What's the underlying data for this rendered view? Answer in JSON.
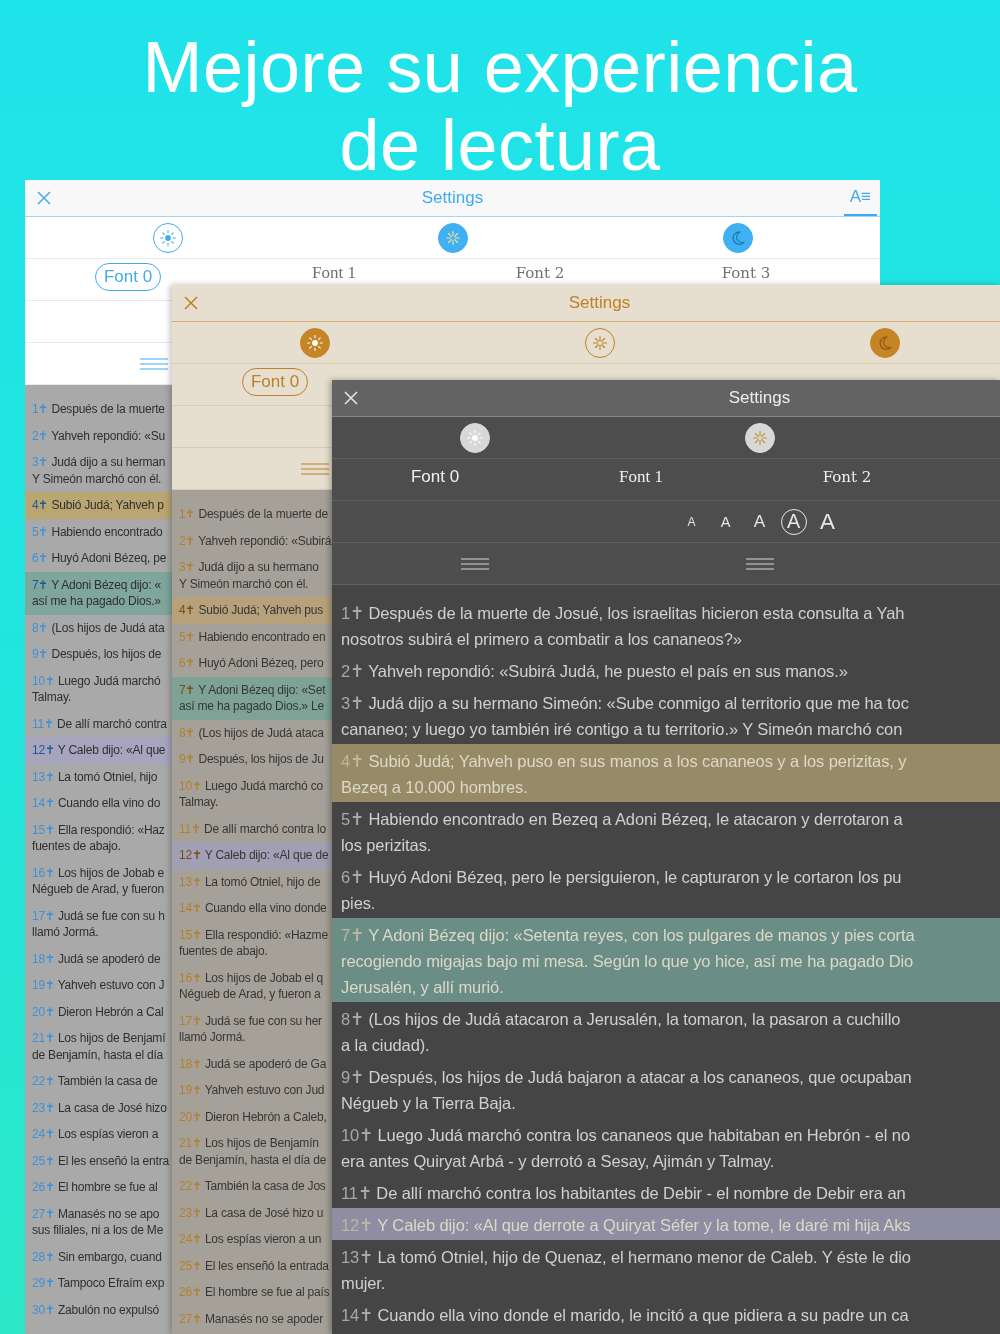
{
  "headline": "Mejore su experiencia de lectura",
  "panels": [
    {
      "kind": "light",
      "title": "Settings",
      "format_button": {
        "label": "A≡",
        "selected": true
      },
      "themes": [
        {
          "kind": "light",
          "selected": true
        },
        {
          "kind": "sepia",
          "selected": false
        },
        {
          "kind": "dark",
          "selected": false
        }
      ],
      "fonts": [
        {
          "label": "Font 0",
          "kind": "sans",
          "selected": true
        },
        {
          "label": "Font 1",
          "kind": "mono",
          "selected": false
        },
        {
          "label": "Font 2",
          "kind": "serif",
          "selected": false
        },
        {
          "label": "Font 3",
          "kind": "serif",
          "selected": false
        }
      ],
      "alignments": [
        {
          "kind": "justify"
        }
      ],
      "verses": [
        {
          "number": "1✝",
          "lines": [
            "Después de la muerte"
          ]
        },
        {
          "number": "2✝",
          "lines": [
            "Yahveh repondió: «Su"
          ]
        },
        {
          "number": "3✝",
          "lines": [
            "Judá dijo a su herman",
            "Y Simeón marchó con él."
          ]
        },
        {
          "number": "4✝",
          "lines": [
            "Subió Judá; Yahveh p"
          ],
          "color": "#b9a673"
        },
        {
          "number": "5✝",
          "lines": [
            "Habiendo encontrado"
          ]
        },
        {
          "number": "6✝",
          "lines": [
            "Huyó Adoni Bézeq, pe"
          ]
        },
        {
          "number": "7✝",
          "lines": [
            "Y Adoni Bézeq dijo: «",
            "así me ha pagado Dios.»"
          ],
          "color": "#7ea69c"
        },
        {
          "number": "8✝",
          "lines": [
            "(Los hijos de Judá ata"
          ]
        },
        {
          "number": "9✝",
          "lines": [
            "Después, los hijos de"
          ]
        },
        {
          "number": "10✝",
          "lines": [
            "Luego Judá marchó",
            "Talmay."
          ]
        },
        {
          "number": "11✝",
          "lines": [
            "De allí marchó contra"
          ]
        },
        {
          "number": "12✝",
          "lines": [
            "Y Caleb dijo: «Al que"
          ],
          "color": "#a7a5bd"
        },
        {
          "number": "13✝",
          "lines": [
            "La tomó Otniel, hijo"
          ]
        },
        {
          "number": "14✝",
          "lines": [
            "Cuando ella vino do"
          ]
        },
        {
          "number": "15✝",
          "lines": [
            "Ella respondió: «Haz",
            "fuentes de abajo."
          ]
        },
        {
          "number": "16✝",
          "lines": [
            "Los hijos de Jobab e",
            "Négueb de Arad, y fueron"
          ]
        },
        {
          "number": "17✝",
          "lines": [
            "Judá se fue con su h",
            "llamó Jormá."
          ]
        },
        {
          "number": "18✝",
          "lines": [
            "Judá se apoderó de"
          ]
        },
        {
          "number": "19✝",
          "lines": [
            "Yahveh estuvo con J"
          ]
        },
        {
          "number": "20✝",
          "lines": [
            "Dieron Hebrón a Cal"
          ]
        },
        {
          "number": "21✝",
          "lines": [
            "Los hijos de Benjamí",
            "de Benjamín, hasta el día"
          ]
        },
        {
          "number": "22✝",
          "lines": [
            "También la casa de"
          ]
        },
        {
          "number": "23✝",
          "lines": [
            "La casa de José hizo"
          ]
        },
        {
          "number": "24✝",
          "lines": [
            "Los espías vieron a"
          ]
        },
        {
          "number": "25✝",
          "lines": [
            "El les enseñó la entra"
          ]
        },
        {
          "number": "26✝",
          "lines": [
            "El hombre se fue al"
          ]
        },
        {
          "number": "27✝",
          "lines": [
            "Manasés no se apo",
            "sus filiales, ni a los de Me"
          ]
        },
        {
          "number": "28✝",
          "lines": [
            "Sin embargo, cuand"
          ]
        },
        {
          "number": "29✝",
          "lines": [
            "Tampoco Efraím exp"
          ]
        },
        {
          "number": "30✝",
          "lines": [
            "Zabulón no expulsó"
          ]
        }
      ]
    },
    {
      "kind": "sepia",
      "title": "Settings",
      "themes": [
        {
          "kind": "light",
          "selected": false
        },
        {
          "kind": "sepia",
          "selected": true
        },
        {
          "kind": "dark",
          "selected": false
        }
      ],
      "fonts": [
        {
          "label": "Font 0",
          "kind": "sans",
          "selected": true
        }
      ],
      "alignments": [
        {
          "kind": "justify"
        }
      ],
      "verses": [
        {
          "number": "1✝",
          "lines": [
            "Después de la muerte de"
          ]
        },
        {
          "number": "2✝",
          "lines": [
            "Yahveh repondió: «Subirá"
          ]
        },
        {
          "number": "3✝",
          "lines": [
            "Judá dijo a su hermano",
            "Y Simeón marchó con él."
          ]
        },
        {
          "number": "4✝",
          "lines": [
            "Subió Judá; Yahveh pus"
          ],
          "color": "#b6a17a"
        },
        {
          "number": "5✝",
          "lines": [
            "Habiendo encontrado en"
          ]
        },
        {
          "number": "6✝",
          "lines": [
            "Huyó Adoni Bézeq, pero"
          ]
        },
        {
          "number": "7✝",
          "lines": [
            "Y Adoni Bézeq dijo: «Set",
            "así me ha pagado Dios.» Le"
          ],
          "color": "#7ea396"
        },
        {
          "number": "8✝",
          "lines": [
            "(Los hijos de Judá ataca"
          ]
        },
        {
          "number": "9✝",
          "lines": [
            "Después, los hijos de Ju"
          ]
        },
        {
          "number": "10✝",
          "lines": [
            "Luego Judá marchó co",
            "Talmay."
          ]
        },
        {
          "number": "11✝",
          "lines": [
            "De allí marchó contra lo"
          ]
        },
        {
          "number": "12✝",
          "lines": [
            "Y Caleb dijo: «Al que de"
          ],
          "color": "#a19fb4"
        },
        {
          "number": "13✝",
          "lines": [
            "La tomó Otniel, hijo de"
          ]
        },
        {
          "number": "14✝",
          "lines": [
            "Cuando ella vino donde"
          ]
        },
        {
          "number": "15✝",
          "lines": [
            "Ella respondió: «Hazme",
            "fuentes de abajo."
          ]
        },
        {
          "number": "16✝",
          "lines": [
            "Los hijos de Jobab el q",
            "Négueb de Arad, y fueron a"
          ]
        },
        {
          "number": "17✝",
          "lines": [
            "Judá se fue con su her",
            "llamó Jormá."
          ]
        },
        {
          "number": "18✝",
          "lines": [
            "Judá se apoderó de Ga"
          ]
        },
        {
          "number": "19✝",
          "lines": [
            "Yahveh estuvo con Jud"
          ]
        },
        {
          "number": "20✝",
          "lines": [
            "Dieron Hebrón a Caleb,"
          ]
        },
        {
          "number": "21✝",
          "lines": [
            "Los hijos de Benjamín",
            "de Benjamín, hasta el día de"
          ]
        },
        {
          "number": "22✝",
          "lines": [
            "También la casa de Jos"
          ]
        },
        {
          "number": "23✝",
          "lines": [
            "La casa de José hizo u"
          ]
        },
        {
          "number": "24✝",
          "lines": [
            "Los espías vieron a un"
          ]
        },
        {
          "number": "25✝",
          "lines": [
            "El les enseñó la entrada"
          ]
        },
        {
          "number": "26✝",
          "lines": [
            "El hombre se fue al país"
          ]
        },
        {
          "number": "27✝",
          "lines": [
            "Manasés no se apoder"
          ]
        }
      ]
    },
    {
      "kind": "dark",
      "title": "Settings",
      "themes": [
        {
          "kind": "light",
          "selected": false
        },
        {
          "kind": "sepia",
          "selected": false
        }
      ],
      "fonts": [
        {
          "label": "Font 0",
          "kind": "sans",
          "selected": false
        },
        {
          "label": "Font 1",
          "kind": "mono",
          "selected": false
        },
        {
          "label": "Font 2",
          "kind": "serif",
          "selected": false
        }
      ],
      "sizes": [
        {
          "label": "A",
          "selected": false
        },
        {
          "label": "A",
          "selected": false
        },
        {
          "label": "A",
          "selected": false
        },
        {
          "label": "A",
          "selected": true
        },
        {
          "label": "A",
          "selected": false
        }
      ],
      "alignments": [
        {
          "kind": "justify"
        },
        {
          "kind": "justify"
        }
      ],
      "verses": [
        {
          "number": "1✝",
          "lines": [
            "Después de la muerte de Josué, los israelitas hicieron esta consulta a Yah",
            "nosotros subirá el primero a combatir a los cananeos?»"
          ]
        },
        {
          "number": "2✝",
          "lines": [
            "Yahveh repondió: «Subirá Judá, he puesto el país en sus manos.»"
          ]
        },
        {
          "number": "3✝",
          "lines": [
            "Judá dijo a su hermano Simeón: «Sube conmigo al territorio que me ha toc",
            "cananeo; y luego yo también iré contigo a tu territorio.» Y Simeón marchó con"
          ]
        },
        {
          "number": "4✝",
          "lines": [
            "Subió Judá; Yahveh puso en sus manos a los cananeos y a los perizitas, y",
            "Bezeq a 10.000 hombres."
          ],
          "color": "#968a67"
        },
        {
          "number": "5✝",
          "lines": [
            "Habiendo encontrado en Bezeq a Adoni Bézeq, le atacaron y derrotaron a",
            "los perizitas."
          ]
        },
        {
          "number": "6✝",
          "lines": [
            "Huyó Adoni Bézeq, pero le persiguieron, le capturaron y le cortaron los pu",
            "pies."
          ]
        },
        {
          "number": "7✝",
          "lines": [
            "Y Adoni Bézeq dijo: «Setenta reyes, con los pulgares de manos y pies corta",
            "recogiendo migajas bajo mi mesa. Según lo que yo hice, así me ha pagado Dio",
            "Jerusalén, y allí murió."
          ],
          "color": "#6a8d86"
        },
        {
          "number": "8✝",
          "lines": [
            "(Los hijos de Judá atacaron a Jerusalén, la tomaron, la pasaron a cuchillo",
            "a la ciudad)."
          ]
        },
        {
          "number": "9✝",
          "lines": [
            "Después, los hijos de Judá bajaron a atacar a los cananeos, que ocupaban",
            "Négueb y la Tierra Baja."
          ]
        },
        {
          "number": "10✝",
          "lines": [
            "Luego Judá marchó contra los cananeos que habitaban en Hebrón - el no",
            "era antes Quiryat Arbá - y derrotó a Sesay, Ajimán y Talmay."
          ]
        },
        {
          "number": "11✝",
          "lines": [
            "De allí marchó contra los habitantes de Debir - el nombre de Debir era an"
          ]
        },
        {
          "number": "12✝",
          "lines": [
            "Y Caleb dijo: «Al que derrote a Quiryat Séfer y la tome, le daré mi hija Aks"
          ],
          "color": "#8f8da1"
        },
        {
          "number": "13✝",
          "lines": [
            "La tomó Otniel, hijo de Quenaz, el hermano menor de Caleb. Y éste le dio",
            "mujer."
          ]
        },
        {
          "number": "14✝",
          "lines": [
            "Cuando ella vino donde el marido, le incitó a que pidiera a su padre un ca"
          ]
        }
      ]
    }
  ]
}
